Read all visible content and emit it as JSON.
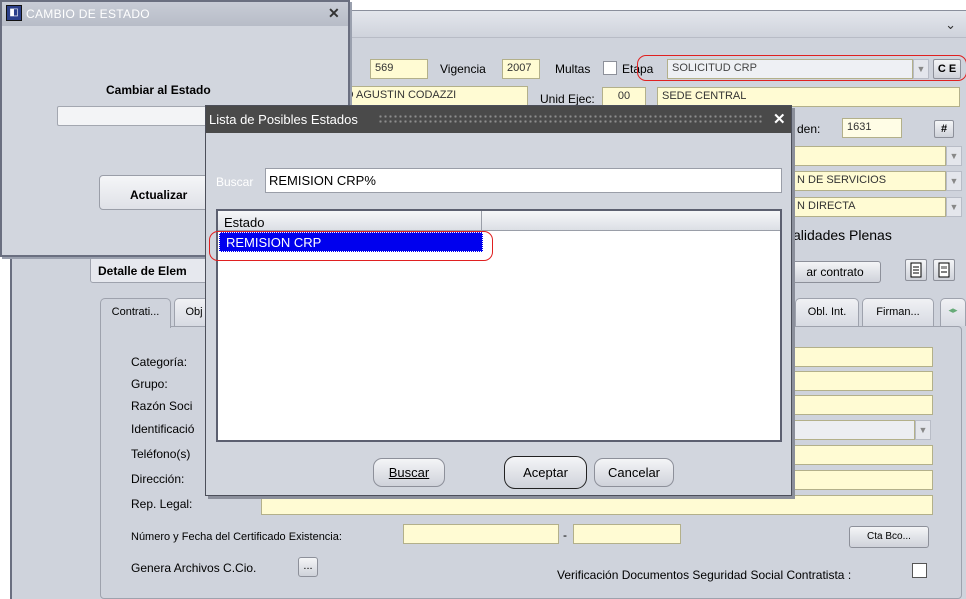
{
  "main": {
    "field_569": "569",
    "vigencia_label": "Vigencia",
    "vigencia_value": "2007",
    "multas_label": "Multas",
    "etapa_label": "Etapa",
    "etapa_value": "SOLICITUD CRP",
    "ce_button": "C E",
    "entity_value": "O AGUSTIN CODAZZI",
    "unid_ejec_label": "Unid Ejec:",
    "unid_ejec_code": "00",
    "unid_ejec_value": "SEDE CENTRAL",
    "orden_label": "den:",
    "orden_value": "1631",
    "hash_button": "#",
    "combo1_value": "",
    "combo2_value": "N DE SERVICIOS",
    "combo3_value": "N DIRECTA",
    "facultades_text": "alidades Plenas",
    "detalle_label": "Detalle de Elem",
    "generar_contrato": "ar contrato",
    "tabs": [
      "Contrati...",
      "Obj",
      "Obl. Int.",
      "Firman..."
    ],
    "tab_arrows": "◂▸",
    "form_labels": [
      "Categoría:",
      "Grupo:",
      "Razón Soci",
      "Identificació",
      "Teléfono(s)",
      "Dirección:",
      "Rep. Legal:"
    ],
    "certificado_label": "Número y Fecha del Certificado Existencia:",
    "certificado_dash": "-",
    "cta_bco_button": "Cta Bco...",
    "genera_archivos_label": "Genera Archivos C.Cio.",
    "genera_archivos_button": "...",
    "verificacion_label": "Verificación Documentos Seguridad Social Contratista :"
  },
  "cambio_dialog": {
    "title": "CAMBIO DE ESTADO",
    "close": "✕",
    "cambiar_label": "Cambiar al Estado",
    "estado_value": "",
    "actualizar_button": "Actualizar"
  },
  "lista_dialog": {
    "title": "Lista de Posibles Estados",
    "close": "✕",
    "buscar_label": "Buscar",
    "buscar_value": "REMISION CRP%",
    "column_header": "Estado",
    "rows": [
      "REMISION CRP"
    ],
    "buscar_button": "Buscar",
    "aceptar_button": "Aceptar",
    "cancelar_button": "Cancelar"
  },
  "colors": {
    "field_bg": "#fffbd3",
    "selection": "#0000ee",
    "highlight_red": "#e02020",
    "dialog_title_dark": "#4a4a4a"
  }
}
